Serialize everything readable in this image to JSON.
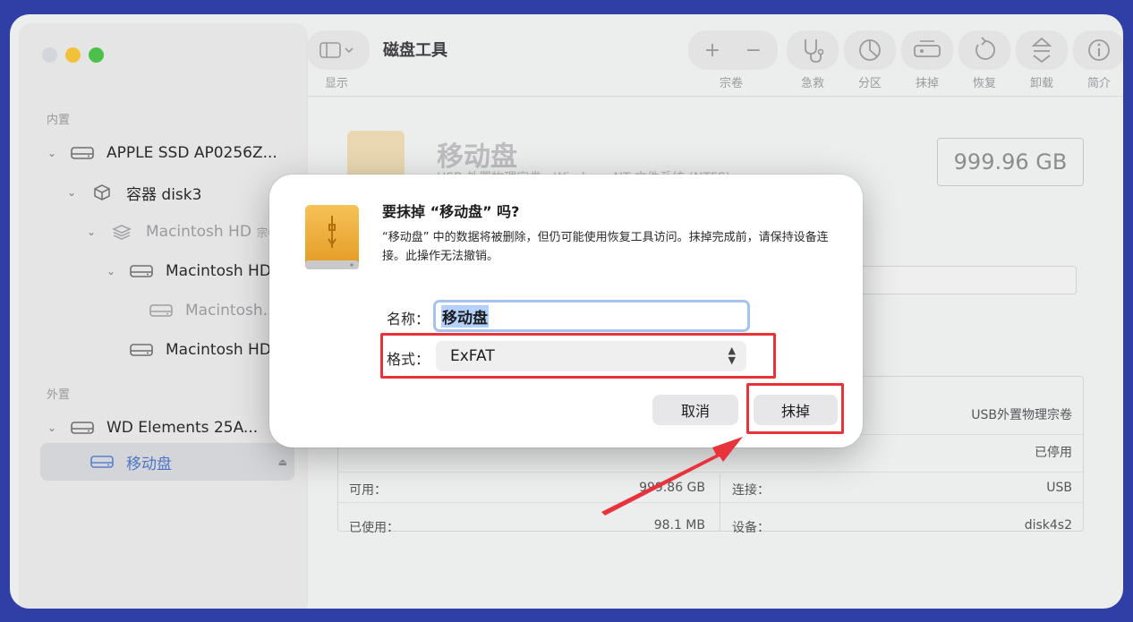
{
  "app": {
    "title": "磁盘工具"
  },
  "toolbar": {
    "view_label": "显示",
    "volume_label": "宗卷",
    "firstaid_label": "急救",
    "partition_label": "分区",
    "erase_label": "抹掉",
    "restore_label": "恢复",
    "unmount_label": "卸载",
    "info_label": "简介",
    "add_glyph": "+",
    "remove_glyph": "−"
  },
  "sidebar": {
    "internal_header": "内置",
    "external_header": "外置",
    "items": [
      {
        "label": "APPLE SSD AP0256Z...",
        "icon": "harddrive-icon"
      },
      {
        "label": "容器 disk3",
        "icon": "container-icon"
      },
      {
        "label": "Macintosh HD",
        "suffix": "宗卷",
        "icon": "layers-icon"
      },
      {
        "label": "Macintosh HD",
        "icon": "harddrive-icon"
      },
      {
        "label": "Macintosh...",
        "icon": "harddrive-icon"
      },
      {
        "label": "Macintosh HD...",
        "icon": "harddrive-icon"
      },
      {
        "label": "WD Elements 25A...",
        "icon": "harddrive-icon"
      },
      {
        "label": "移动盘",
        "icon": "harddrive-icon"
      }
    ],
    "eject_glyph": "⏏"
  },
  "main": {
    "drive_name": "移动盘",
    "drive_sub": "USB 外置物理宗卷 · Windows NT 文件系统 (NTFS)",
    "capacity": "999.96 GB",
    "info": {
      "type_value": "USB外置物理宗卷",
      "owners_value": "已停用",
      "available_label": "可用：",
      "available_value": "999.86 GB",
      "used_label": "已使用：",
      "used_value": "98.1 MB",
      "connection_label": "连接：",
      "connection_value": "USB",
      "device_label": "设备：",
      "device_value": "disk4s2"
    }
  },
  "dialog": {
    "title": "要抹掉 “移动盘” 吗?",
    "message": "“移动盘” 中的数据将被删除，但仍可能使用恢复工具访问。抹掉完成前，请保持设备连接。此操作无法撤销。",
    "name_label": "名称：",
    "name_value": "移动盘",
    "format_label": "格式：",
    "format_value": "ExFAT",
    "cancel_label": "取消",
    "erase_label": "抹掉"
  },
  "colors": {
    "annotation": "#e8333d",
    "desktop": "#2f3fa6",
    "accent": "#4f76c6"
  }
}
